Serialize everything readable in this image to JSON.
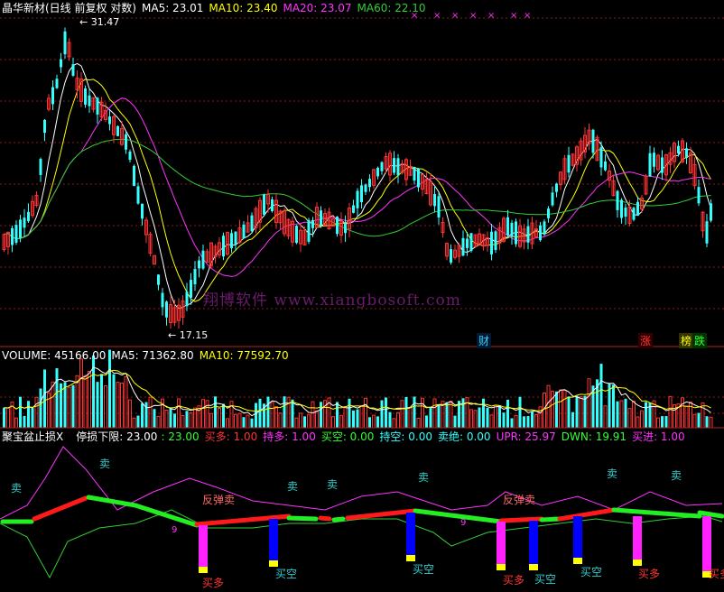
{
  "main_header": {
    "title": "晶华新材(日线 前复权 对数)",
    "ma5": "MA5: 23.01",
    "ma10": "MA10: 23.40",
    "ma20": "MA20: 23.07",
    "ma60": "MA60: 22.10"
  },
  "price_labels": {
    "high": "31.47",
    "low": "17.15"
  },
  "watermark": "翔博软件 www.xiangbosoft.com",
  "event_badges": {
    "cai": "财",
    "zhang": "涨",
    "bang": "榜",
    "die": "跌"
  },
  "volume_header": {
    "volume": "VOLUME: 45166.00",
    "ma5": "MA5: 71362.80",
    "ma10": "MA10: 77592.70"
  },
  "indicator_header": {
    "name": "聚宝盆止损X",
    "stop_label": "停损下限: 23.00",
    "stop_value": ": 23.00",
    "buy_long": "买多: 1.00",
    "hold_long": "持多: 1.00",
    "buy_short": "买空: 0.00",
    "hold_short": "持空: 0.00",
    "sell_out": "卖绝: 0.00",
    "upr": "UPR: 25.97",
    "dwn": "DWN: 19.91",
    "buy_in": "买进: 1.00"
  },
  "signals": {
    "sell": "卖",
    "rebound_sell": "反弹卖",
    "buy_long": "买多",
    "buy_short": "买空",
    "nine": "9"
  },
  "colors": {
    "up": "#ff3333",
    "down": "#33ffff",
    "ma5": "#ffffff",
    "ma10": "#ffff00",
    "ma20": "#ff33ff",
    "ma60": "#33cc33",
    "grid": "#8b1a1a",
    "magenta_bar": "#ff22ff",
    "blue_bar": "#0000ff",
    "yellow_cap": "#ffff00",
    "red_thick": "#ff1a1a",
    "green_thick": "#22ee22"
  }
}
